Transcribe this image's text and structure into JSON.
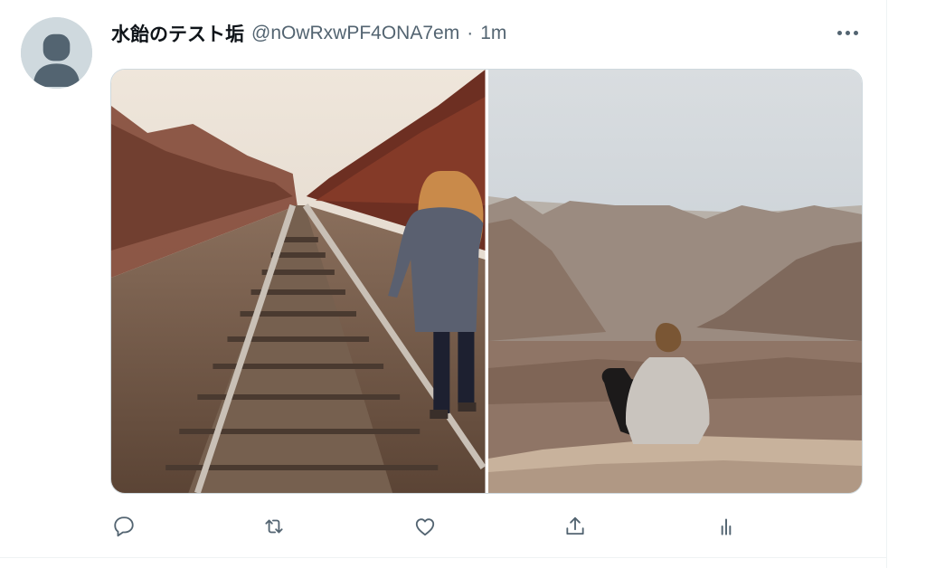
{
  "tweet": {
    "author_name": "水飴のテスト垢",
    "handle": "@nOwRxwPF4ONA7em",
    "separator": "·",
    "timestamp": "1m"
  },
  "media": [
    {
      "subject": "woman walking along railroad tracks",
      "kind": "photo"
    },
    {
      "subject": "person and dog sitting at canyon overlook",
      "kind": "photo"
    }
  ],
  "icons": {
    "more": "more-icon",
    "reply": "reply-icon",
    "retweet": "retweet-icon",
    "like": "like-icon",
    "share": "share-icon",
    "analytics": "analytics-icon"
  },
  "colors": {
    "text": "#0f1419",
    "secondary": "#536471",
    "border": "#cfd9de",
    "avatar_bg": "#cfd9de"
  }
}
